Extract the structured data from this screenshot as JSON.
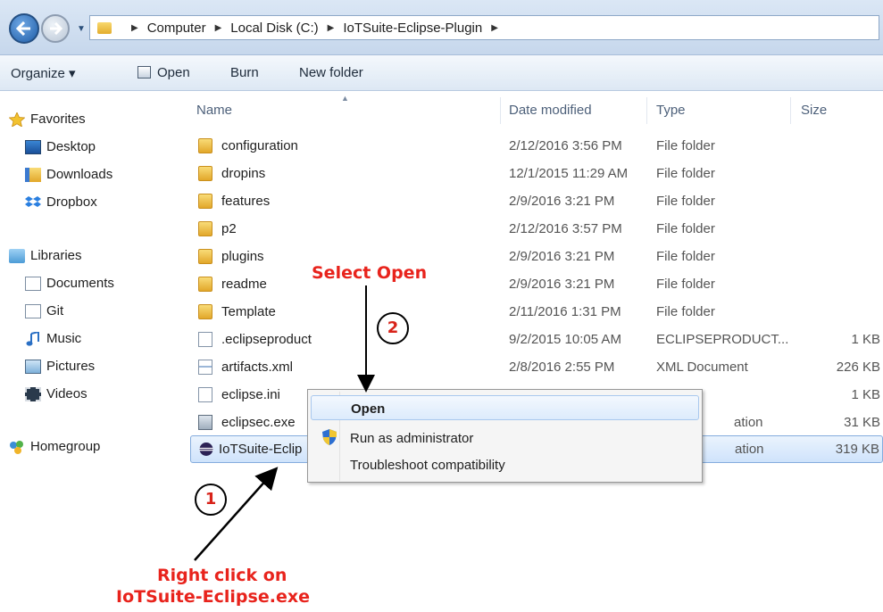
{
  "address_bar": {
    "breadcrumbs": [
      "Computer",
      "Local Disk (C:)",
      "IoTSuite-Eclipse-Plugin"
    ]
  },
  "toolbar": {
    "organize_label": "Organize ▾",
    "open_label": "Open",
    "burn_label": "Burn",
    "new_folder_label": "New folder"
  },
  "nav_pane": {
    "favorites": {
      "label": "Favorites",
      "items": [
        "Desktop",
        "Downloads",
        "Dropbox"
      ]
    },
    "libraries": {
      "label": "Libraries",
      "items": [
        "Documents",
        "Git",
        "Music",
        "Pictures",
        "Videos"
      ]
    },
    "homegroup": {
      "label": "Homegroup"
    }
  },
  "file_list": {
    "columns": {
      "name": "Name",
      "date": "Date modified",
      "type": "Type",
      "size": "Size"
    },
    "rows": [
      {
        "name": "configuration",
        "date": "2/12/2016 3:56 PM",
        "type": "File folder",
        "size": "",
        "icon": "folder-icon"
      },
      {
        "name": "dropins",
        "date": "12/1/2015 11:29 AM",
        "type": "File folder",
        "size": "",
        "icon": "folder-icon"
      },
      {
        "name": "features",
        "date": "2/9/2016 3:21 PM",
        "type": "File folder",
        "size": "",
        "icon": "folder-icon"
      },
      {
        "name": "p2",
        "date": "2/12/2016 3:57 PM",
        "type": "File folder",
        "size": "",
        "icon": "folder-icon"
      },
      {
        "name": "plugins",
        "date": "2/9/2016 3:21 PM",
        "type": "File folder",
        "size": "",
        "icon": "folder-icon"
      },
      {
        "name": "readme",
        "date": "2/9/2016 3:21 PM",
        "type": "File folder",
        "size": "",
        "icon": "folder-icon"
      },
      {
        "name": "Template",
        "date": "2/11/2016 1:31 PM",
        "type": "File folder",
        "size": "",
        "icon": "folder-icon"
      },
      {
        "name": ".eclipseproduct",
        "date": "9/2/2015 10:05 AM",
        "type": "ECLIPSEPRODUCT...",
        "size": "1 KB",
        "icon": "blank-file-icon"
      },
      {
        "name": "artifacts.xml",
        "date": "2/8/2016 2:55 PM",
        "type": "XML Document",
        "size": "226 KB",
        "icon": "xml-file-icon"
      },
      {
        "name": "eclipse.ini",
        "date": "",
        "type": "",
        "size": "1 KB",
        "icon": "settings-file-icon"
      },
      {
        "name": "eclipsec.exe",
        "date": "",
        "type": "ation",
        "size": "31 KB",
        "icon": "exe-icon"
      },
      {
        "name": "IoTSuite-Eclip",
        "date": "",
        "type": "ation",
        "size": "319 KB",
        "icon": "eclipse-icon"
      }
    ]
  },
  "context_menu": {
    "items": [
      "Open",
      "Run as administrator",
      "Troubleshoot compatibility"
    ]
  },
  "annotations": {
    "select_open": "Select Open",
    "right_click_line1": "Right click on",
    "right_click_line2": "IoTSuite-Eclipse.exe",
    "step1": "1",
    "step2": "2"
  }
}
